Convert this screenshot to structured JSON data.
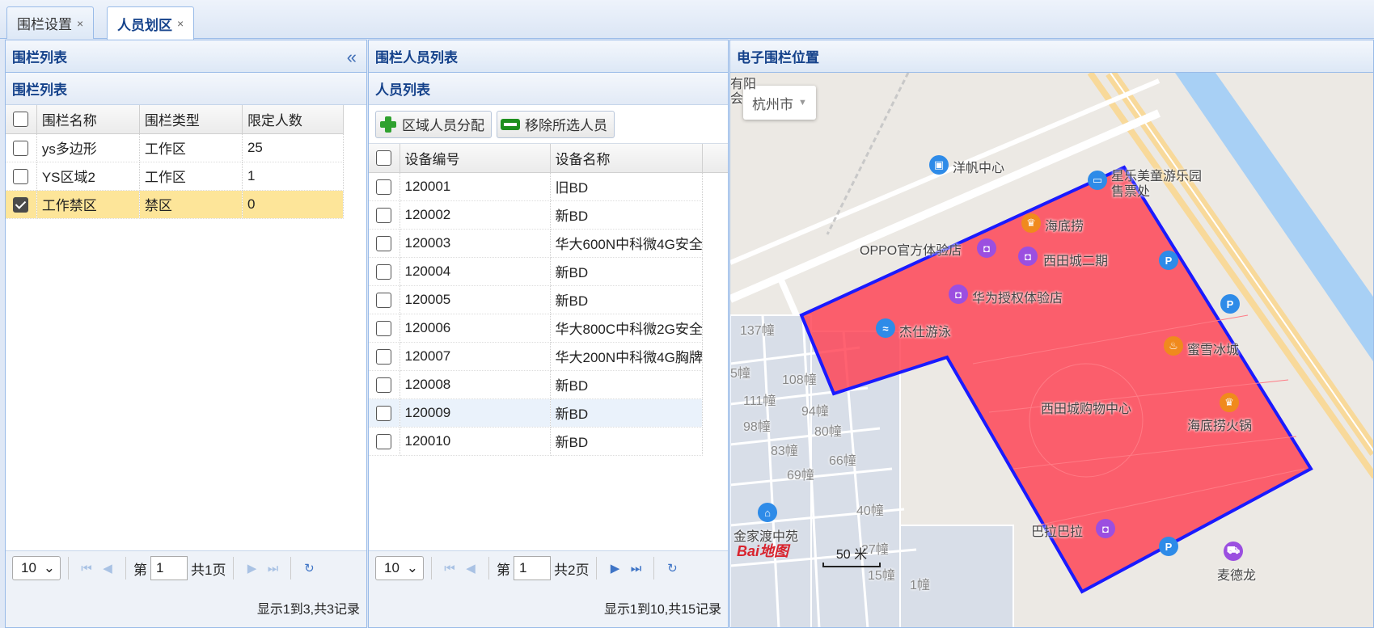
{
  "tabs": [
    {
      "label": "围栏设置",
      "close": "×"
    },
    {
      "label": "人员划区",
      "close": "×"
    }
  ],
  "fence_panel": {
    "title": "围栏列表",
    "sub_title": "围栏列表",
    "columns": [
      "围栏名称",
      "围栏类型",
      "限定人数"
    ],
    "rows": [
      {
        "name": "ys多边形",
        "type": "工作区",
        "limit": "25",
        "checked": false
      },
      {
        "name": "YS区域2",
        "type": "工作区",
        "limit": "1",
        "checked": false
      },
      {
        "name": "工作禁区",
        "type": "禁区",
        "limit": "0",
        "checked": true
      }
    ],
    "pager": {
      "page_size": "10",
      "page_prefix": "第",
      "page": "1",
      "total_pages": "共1页",
      "info": "显示1到3,共3记录"
    }
  },
  "person_panel": {
    "title": "围栏人员列表",
    "sub_title": "人员列表",
    "toolbar": {
      "assign_label": "区域人员分配",
      "remove_label": "移除所选人员"
    },
    "columns": [
      "设备编号",
      "设备名称"
    ],
    "rows": [
      {
        "id": "120001",
        "name": "旧BD"
      },
      {
        "id": "120002",
        "name": "新BD"
      },
      {
        "id": "120003",
        "name": "华大600N中科微4G安全"
      },
      {
        "id": "120004",
        "name": "新BD"
      },
      {
        "id": "120005",
        "name": "新BD"
      },
      {
        "id": "120006",
        "name": "华大800C中科微2G安全"
      },
      {
        "id": "120007",
        "name": "华大200N中科微4G胸牌"
      },
      {
        "id": "120008",
        "name": "新BD"
      },
      {
        "id": "120009",
        "name": "新BD"
      },
      {
        "id": "120010",
        "name": "新BD"
      }
    ],
    "pager": {
      "page_size": "10",
      "page_prefix": "第",
      "page": "1",
      "total_pages": "共2页",
      "info": "显示1到10,共15记录"
    }
  },
  "map_panel": {
    "title": "电子围栏位置",
    "city": "杭州市",
    "scale_label": "50 米",
    "logo": "Bai地图",
    "labels": {
      "l1": "洋帆中心",
      "l2": "星乐美童游乐园",
      "l2b": "售票处",
      "l3": "海底捞",
      "l4": "OPPO官方体验店",
      "l5": "西田城二期",
      "l6": "华为授权体验店",
      "l7": "杰仕游泳",
      "l8": "蜜雪冰城",
      "l9": "西田城购物中心",
      "l10": "海底捞火锅",
      "l11": "巴拉巴拉",
      "l12": "金家渡中苑",
      "l13": "麦德龙",
      "b1": "137幢",
      "b2": "108幢",
      "b3": "111幢",
      "b4": "94幢",
      "b5": "98幢",
      "b6": "80幢",
      "b7": "83幢",
      "b8": "66幢",
      "b9": "69幢",
      "b10": "40幢",
      "b11": "27幢",
      "b12": "15幢",
      "b13": "5幢",
      "b14": "1幢",
      "b15": "有阳",
      "b16": "会"
    },
    "fence_color": "#ff3b4e",
    "fence_border": "#1a1aff"
  }
}
